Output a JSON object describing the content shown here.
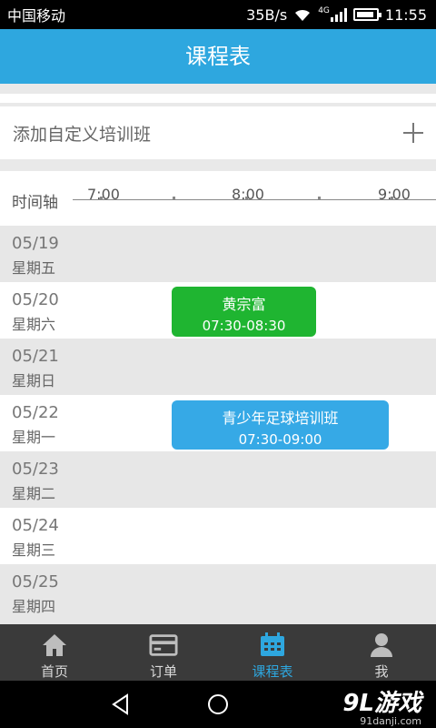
{
  "status": {
    "carrier": "中国移动",
    "speed": "35B/s",
    "network": "4G",
    "time": "11:55"
  },
  "header": {
    "title": "课程表"
  },
  "add_row": {
    "label": "添加自定义培训班",
    "icon": "plus-icon"
  },
  "timeline": {
    "label": "时间轴",
    "ticks": [
      "7:00",
      "8:00",
      "9:00"
    ]
  },
  "days": [
    {
      "date": "05/19",
      "weekday": "星期五"
    },
    {
      "date": "05/20",
      "weekday": "星期六"
    },
    {
      "date": "05/21",
      "weekday": "星期日"
    },
    {
      "date": "05/22",
      "weekday": "星期一"
    },
    {
      "date": "05/23",
      "weekday": "星期二"
    },
    {
      "date": "05/24",
      "weekday": "星期三"
    },
    {
      "date": "05/25",
      "weekday": "星期四"
    }
  ],
  "events": [
    {
      "name": "黄宗富",
      "time": "07:30-08:30",
      "day": "05/20",
      "color": "#1fb531"
    },
    {
      "name": "青少年足球培训班",
      "time": "07:30-09:00",
      "day": "05/22",
      "color": "#36a9e6"
    }
  ],
  "tabs": [
    {
      "label": "首页",
      "icon": "home-icon",
      "active": false
    },
    {
      "label": "订单",
      "icon": "card-icon",
      "active": false
    },
    {
      "label": "课程表",
      "icon": "calendar-icon",
      "active": true
    },
    {
      "label": "我",
      "icon": "user-icon",
      "active": false
    }
  ],
  "watermark": {
    "brand": "9L游戏",
    "site": "91danji.com"
  },
  "colors": {
    "accent": "#2ea7df",
    "tabbar": "#3a3a3a"
  }
}
